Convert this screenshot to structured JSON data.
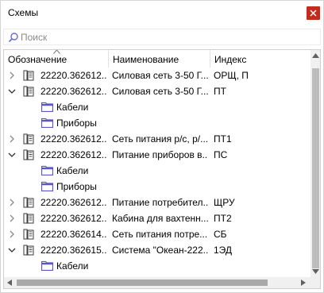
{
  "window": {
    "title": "Схемы"
  },
  "search": {
    "placeholder": "Поиск",
    "value": ""
  },
  "columns": [
    {
      "label": "Обозначение",
      "sorted": "ascending"
    },
    {
      "label": "Наименование"
    },
    {
      "label": "Индекс"
    }
  ],
  "rows": [
    {
      "kind": "scheme",
      "expanded": false,
      "designation": "22220.362612...",
      "name": "Силовая сеть 3-50 Г...",
      "index": "ОРЩ, П"
    },
    {
      "kind": "scheme",
      "expanded": true,
      "designation": "22220.362612...",
      "name": "Силовая сеть 3-50 Г...",
      "index": "ПТ"
    },
    {
      "kind": "child",
      "label": "Кабели"
    },
    {
      "kind": "child",
      "label": "Приборы"
    },
    {
      "kind": "scheme",
      "expanded": false,
      "designation": "22220.362612...",
      "name": "Сеть питания р/с, р/...",
      "index": "ПТ1"
    },
    {
      "kind": "scheme",
      "expanded": true,
      "designation": "22220.362612...",
      "name": "Питание приборов в...",
      "index": "ПС"
    },
    {
      "kind": "child",
      "label": "Кабели"
    },
    {
      "kind": "child",
      "label": "Приборы"
    },
    {
      "kind": "scheme",
      "expanded": false,
      "designation": "22220.362612...",
      "name": "Питание потребител...",
      "index": "ЩРУ"
    },
    {
      "kind": "scheme",
      "expanded": false,
      "designation": "22220.362612...",
      "name": "Кабина для вахтенн...",
      "index": "ПТ2"
    },
    {
      "kind": "scheme",
      "expanded": false,
      "designation": "22220.362614...",
      "name": "Сеть питания потре...",
      "index": "СБ"
    },
    {
      "kind": "scheme",
      "expanded": true,
      "designation": "22220.362615...",
      "name": "Система \"Океан-222...",
      "index": "1ЭД"
    },
    {
      "kind": "child",
      "label": "Кабели"
    }
  ],
  "colors": {
    "close_button": "#c42b1c",
    "folder": "#5a55c8",
    "scroll_thumb": "#bdbdbd"
  },
  "icons": {
    "close": "close-icon",
    "search": "search-icon",
    "scheme": "document-icon",
    "group": "folder-icon",
    "collapsed": "chevron-right-icon",
    "expanded": "chevron-down-icon"
  }
}
